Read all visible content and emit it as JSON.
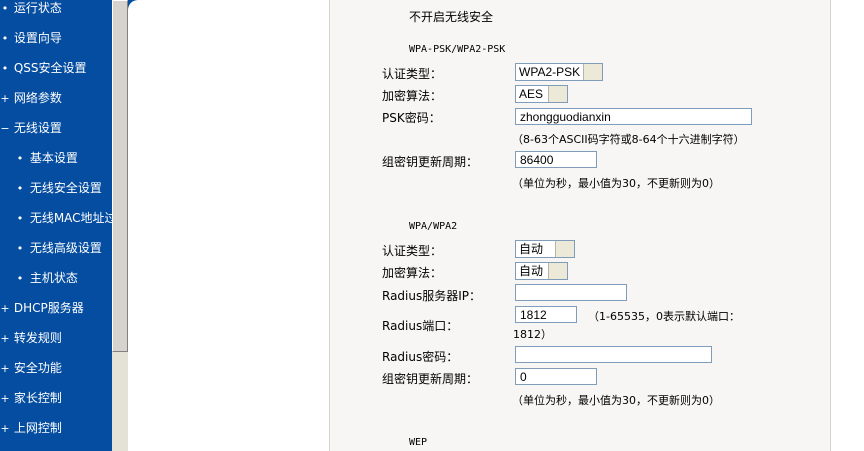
{
  "sidebar": {
    "items": [
      {
        "mark": "•",
        "label": "运行状态"
      },
      {
        "mark": "•",
        "label": "设置向导"
      },
      {
        "mark": "•",
        "label": "QSS安全设置"
      },
      {
        "mark": "+",
        "label": "网络参数"
      },
      {
        "mark": "−",
        "label": "无线设置"
      },
      {
        "mark": "•",
        "label": "基本设置"
      },
      {
        "mark": "•",
        "label": "无线安全设置"
      },
      {
        "mark": "•",
        "label": "无线MAC地址过滤"
      },
      {
        "mark": "•",
        "label": "无线高级设置"
      },
      {
        "mark": "•",
        "label": "主机状态"
      },
      {
        "mark": "+",
        "label": "DHCP服务器"
      },
      {
        "mark": "+",
        "label": "转发规则"
      },
      {
        "mark": "+",
        "label": "安全功能"
      },
      {
        "mark": "+",
        "label": "家长控制"
      },
      {
        "mark": "+",
        "label": "上网控制"
      }
    ]
  },
  "main": {
    "no_security_label": "不开启无线安全",
    "wpa_psk": {
      "section_title": "WPA-PSK/WPA2-PSK",
      "auth_type_label": "认证类型：",
      "auth_type_value": "WPA2-PSK",
      "encryption_label": "加密算法：",
      "encryption_value": "AES",
      "psk_label": "PSK密码：",
      "psk_value": "zhongguodianxin",
      "psk_hint": "（8-63个ASCII码字符或8-64个十六进制字符）",
      "group_key_label": "组密钥更新周期：",
      "group_key_value": "86400",
      "group_key_hint": "（单位为秒，最小值为30，不更新则为0）"
    },
    "wpa": {
      "section_title": "WPA/WPA2",
      "auth_type_label": "认证类型：",
      "auth_type_value": "自动",
      "encryption_label": "加密算法：",
      "encryption_value": "自动",
      "radius_ip_label": "Radius服务器IP：",
      "radius_ip_value": "",
      "radius_port_label": "Radius端口：",
      "radius_port_value": "1812",
      "radius_port_hint": "（1-65535，0表示默认端口：",
      "radius_port_hint2": "1812）",
      "radius_pw_label": "Radius密码：",
      "radius_pw_value": "",
      "group_key_label": "组密钥更新周期：",
      "group_key_value": "0",
      "group_key_hint": "（单位为秒，最小值为30，不更新则为0）"
    },
    "wep": {
      "section_title": "WEP"
    }
  },
  "colors": {
    "sidebar_bg": "#054da1",
    "panel_bg": "#f7f6f4",
    "field_border": "#7f9db9"
  }
}
